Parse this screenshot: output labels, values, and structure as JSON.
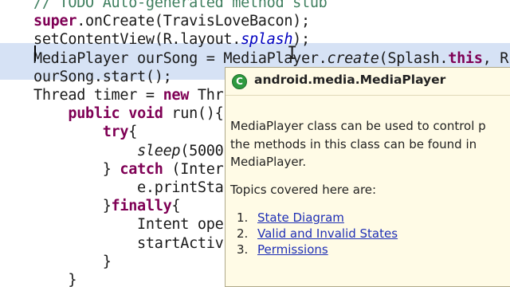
{
  "editor": {
    "lines": [
      {
        "segments": [
          {
            "t": "// TODO Auto-generated method stub",
            "c": "cm"
          }
        ]
      },
      {
        "segments": [
          {
            "t": "super",
            "c": "kw"
          },
          {
            "t": ".onCreate(TravisLoveBacon);"
          }
        ]
      },
      {
        "segments": [
          {
            "t": "setContentView(R.layout."
          },
          {
            "t": "splash",
            "c": "fld ital"
          },
          {
            "t": ");"
          }
        ]
      },
      {
        "segments": [
          {
            "t": "MediaPlayer ourSong = MediaPlayer."
          },
          {
            "t": "create",
            "c": "ital"
          },
          {
            "t": "(Splash."
          },
          {
            "t": "this",
            "c": "kw"
          },
          {
            "t": ", R"
          }
        ]
      },
      {
        "segments": [
          {
            "t": "ourSong.start();"
          }
        ]
      },
      {
        "segments": [
          {
            "t": "Thread timer = "
          },
          {
            "t": "new",
            "c": "kw"
          },
          {
            "t": " Thr"
          }
        ]
      },
      {
        "segments": [
          {
            "t": "    "
          },
          {
            "t": "public void",
            "c": "kw"
          },
          {
            "t": " run(){"
          }
        ]
      },
      {
        "segments": [
          {
            "t": "        "
          },
          {
            "t": "try",
            "c": "kw"
          },
          {
            "t": "{"
          }
        ]
      },
      {
        "segments": [
          {
            "t": "            "
          },
          {
            "t": "sleep",
            "c": "ital"
          },
          {
            "t": "(5000"
          }
        ]
      },
      {
        "segments": [
          {
            "t": "        } "
          },
          {
            "t": "catch",
            "c": "kw"
          },
          {
            "t": " (Inter"
          }
        ]
      },
      {
        "segments": [
          {
            "t": "            e.printSta"
          }
        ]
      },
      {
        "segments": [
          {
            "t": "        }"
          },
          {
            "t": "finally",
            "c": "kw"
          },
          {
            "t": "{"
          }
        ]
      },
      {
        "segments": [
          {
            "t": "            Intent ope"
          }
        ]
      },
      {
        "segments": [
          {
            "t": "            startActiv"
          }
        ]
      },
      {
        "segments": [
          {
            "t": "        }"
          }
        ]
      },
      {
        "segments": [
          {
            "t": "    }"
          }
        ]
      }
    ]
  },
  "popup": {
    "icon_glyph": "C",
    "icon_name": "class-icon",
    "title": "android.media.MediaPlayer",
    "description_lines": [
      "MediaPlayer class can be used to control p",
      "the methods in this class can be found in",
      "MediaPlayer."
    ],
    "topics_label": "Topics covered here are:",
    "topics": [
      {
        "num": "1.",
        "label": "State Diagram"
      },
      {
        "num": "2.",
        "label": "Valid and Invalid States"
      },
      {
        "num": "3.",
        "label": "Permissions"
      }
    ],
    "link_color": "#1f2fb5",
    "background_color": "#fffbe6"
  }
}
